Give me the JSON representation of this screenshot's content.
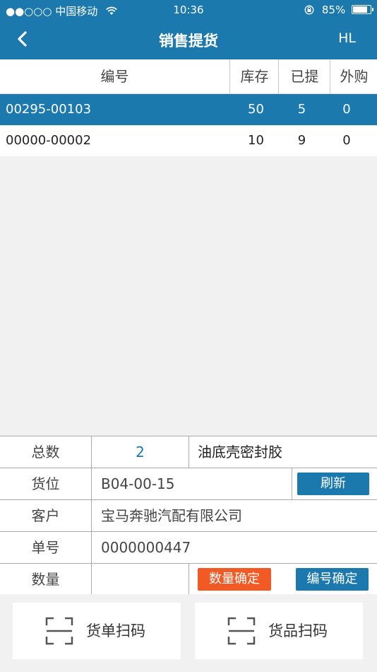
{
  "status_bar": {
    "carrier": "●●○○○ 中国移动",
    "time": "10:36",
    "battery": "85%",
    "battery_level": 0.85
  },
  "nav": {
    "title": "销售提货",
    "right": "HL"
  },
  "table": {
    "headers": {
      "code": "编号",
      "stock": "库存",
      "picked": "已提",
      "outside": "外购"
    },
    "rows": [
      {
        "code": "00295-00103",
        "stock": "50",
        "picked": "5",
        "outside": "0",
        "selected": true
      },
      {
        "code": "00000-00002",
        "stock": "10",
        "picked": "9",
        "outside": "0",
        "selected": false
      }
    ]
  },
  "form": {
    "total_label": "总数",
    "total_value": "2",
    "product_name": "油底壳密封胶",
    "location_label": "货位",
    "location_value": "B04-00-15",
    "refresh_label": "刷新",
    "customer_label": "客户",
    "customer_value": "宝马奔驰汽配有限公司",
    "order_label": "单号",
    "order_value": "0000000447",
    "quantity_label": "数量",
    "quantity_value": "",
    "confirm_qty_label": "数量确定",
    "confirm_code_label": "编号确定"
  },
  "scan": {
    "order_scan_label": "货单扫码",
    "goods_scan_label": "货品扫码"
  },
  "colors": {
    "primary": "#1c79ad",
    "accent": "#f15a24"
  }
}
